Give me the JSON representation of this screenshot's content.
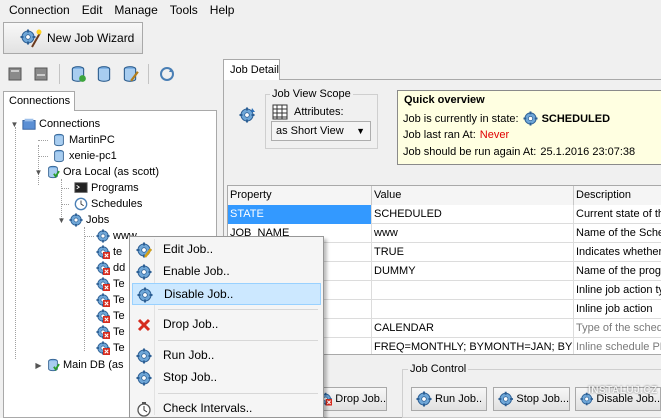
{
  "menu": [
    "Connection",
    "Edit",
    "Manage",
    "Tools",
    "Help"
  ],
  "toolbar": {
    "wizard_label": "New Job Wizard"
  },
  "connections_tab": "Connections",
  "tree": [
    {
      "label": "Connections",
      "icon": "connections-icon"
    },
    {
      "label": "MartinPC",
      "icon": "database-icon"
    },
    {
      "label": "xenie-pc1",
      "icon": "database-icon"
    },
    {
      "label": "Ora Local (as scott)",
      "icon": "database-connected-icon"
    },
    {
      "label": "Programs",
      "icon": "programs-icon"
    },
    {
      "label": "Schedules",
      "icon": "schedules-icon"
    },
    {
      "label": "Jobs",
      "icon": "jobs-icon"
    },
    {
      "label": "www",
      "icon": "job-gear-icon"
    },
    {
      "label": "te",
      "icon": "job-gear-red-icon"
    },
    {
      "label": "dd",
      "icon": "job-gear-red-icon"
    },
    {
      "label": "Te",
      "icon": "job-gear-red-icon"
    },
    {
      "label": "Te",
      "icon": "job-gear-red-icon"
    },
    {
      "label": "Te",
      "icon": "job-gear-red-icon"
    },
    {
      "label": "Te",
      "icon": "job-gear-red-icon"
    },
    {
      "label": "Te",
      "icon": "job-gear-red-icon"
    },
    {
      "label": "Main DB (as",
      "icon": "database-connected-icon"
    }
  ],
  "job_detail_tab": "Job Detail",
  "scope": {
    "title": "Job View Scope",
    "attributes_label": "Attributes:",
    "selected": "as Short View"
  },
  "quick_overview": {
    "title": "Quick overview",
    "state_label": "Job is currently in state:",
    "state_value": "SCHEDULED",
    "last_ran_label": "Job last ran At:",
    "last_ran_value": "Never",
    "next_run_label": "Job should be run again At:",
    "next_run_value": "25.1.2016 23:07:38"
  },
  "grid": {
    "headers": [
      "Property",
      "Value",
      "Description"
    ],
    "rows": [
      [
        "STATE",
        "SCHEDULED",
        "Current state of th"
      ],
      [
        "JOB_NAME",
        "www",
        "Name of the Sched"
      ],
      [
        "",
        "TRUE",
        "Indicates whether"
      ],
      [
        "",
        "DUMMY",
        "Name of the progr"
      ],
      [
        "",
        "",
        "Inline job action ty"
      ],
      [
        "",
        "",
        "Inline job action"
      ],
      [
        "",
        "CALENDAR",
        "Type of the sched"
      ],
      [
        "",
        "FREQ=MONTHLY; BYMONTH=JAN; BYDAY",
        "Inline schedule PL"
      ]
    ]
  },
  "job_control": {
    "title": "Job Control",
    "drop_label": "Drop Job..",
    "run_label": "Run Job..",
    "stop_label": "Stop Job...",
    "disable_label": "Disable Job.."
  },
  "context_menu": {
    "items": [
      {
        "label": "Edit Job..",
        "icon": "edit-job-icon"
      },
      {
        "label": "Enable Job..",
        "icon": "enable-job-icon"
      },
      {
        "label": "Disable Job..",
        "icon": "disable-job-icon"
      },
      {
        "label": "Drop Job..",
        "icon": "drop-job-icon"
      },
      {
        "label": "Run Job..",
        "icon": "run-job-icon"
      },
      {
        "label": "Stop Job..",
        "icon": "stop-job-icon"
      },
      {
        "label": "Check Intervals..",
        "icon": "check-intervals-icon"
      }
    ]
  },
  "watermark": "INSTALUJ.CZ",
  "colors": {
    "selection": "#3399ff",
    "menu_highlight": "#cce8ff",
    "tooltip_bg": "#ffffe1",
    "error_text": "#e00000"
  }
}
